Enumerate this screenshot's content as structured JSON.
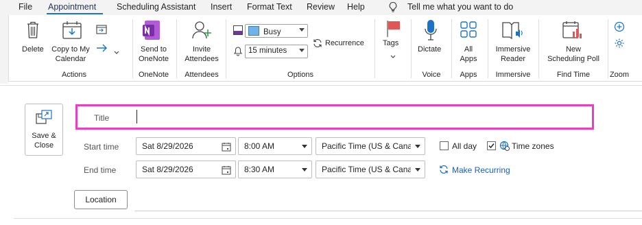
{
  "menu": {
    "items": [
      "File",
      "Appointment",
      "Scheduling Assistant",
      "Insert",
      "Format Text",
      "Review",
      "Help"
    ],
    "tell_me": "Tell me what you want to do"
  },
  "ribbon": {
    "delete": "Delete",
    "copy_to_my_calendar_line1": "Copy to My",
    "copy_to_my_calendar_line2": "Calendar",
    "group_actions": "Actions",
    "send_to_onenote_line1": "Send to",
    "send_to_onenote_line2": "OneNote",
    "group_onenote": "OneNote",
    "invite_attendees_line1": "Invite",
    "invite_attendees_line2": "Attendees",
    "group_attendees": "Attendees",
    "show_as_value": "Busy",
    "reminder_value": "15 minutes",
    "recurrence": "Recurrence",
    "group_options": "Options",
    "tags": "Tags",
    "dictate": "Dictate",
    "group_voice": "Voice",
    "all_apps_line1": "All",
    "all_apps_line2": "Apps",
    "group_apps": "Apps",
    "immersive_reader_line1": "Immersive",
    "immersive_reader_line2": "Reader",
    "group_immersive": "Immersive",
    "new_poll_line1": "New",
    "new_poll_line2": "Scheduling Poll",
    "group_find_time": "Find Time",
    "group_zoom": "Zoom"
  },
  "form": {
    "save_close_line1": "Save &",
    "save_close_line2": "Close",
    "title_label": "Title",
    "title_value": "",
    "start_time_label": "Start time",
    "start_date": "Sat 8/29/2026",
    "start_time": "8:00 AM",
    "start_tz": "Pacific Time (US & Cana",
    "all_day_label": "All day",
    "all_day_checked": false,
    "time_zones_label": "Time zones",
    "time_zones_checked": true,
    "end_time_label": "End time",
    "end_date": "Sat 8/29/2026",
    "end_time": "8:30 AM",
    "end_tz": "Pacific Time (US & Cana",
    "make_recurring": "Make Recurring",
    "location_button": "Location",
    "location_value": ""
  },
  "colors": {
    "accent": "#1a73c8",
    "title_highlight": "#e83fc0",
    "busy_chip": "#6fb3e8",
    "tag_red": "#e05555",
    "onenote_purple": "#7a2fa6"
  }
}
